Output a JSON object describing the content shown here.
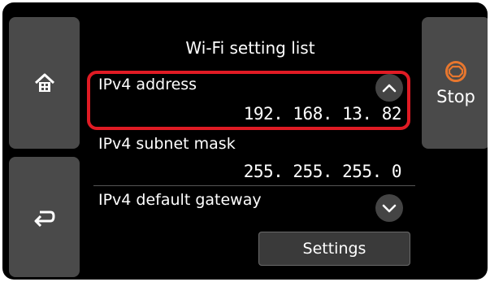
{
  "header": {
    "title": "Wi-Fi setting list"
  },
  "nav": {
    "home_icon": "home-icon",
    "back_icon": "back-arrow-icon",
    "stop_label": "Stop",
    "stop_icon": "stop-icon",
    "stop_color": "#e8772e"
  },
  "settings_list": {
    "items": [
      {
        "label": "IPv4 address",
        "value": "192. 168. 13. 82"
      },
      {
        "label": "IPv4 subnet mask",
        "value": "255. 255. 255. 0"
      },
      {
        "label": "IPv4 default gateway",
        "value": ""
      }
    ],
    "highlight_color": "#e01b24",
    "scroll_up_icon": "chevron-up-icon",
    "scroll_down_icon": "chevron-down-icon"
  },
  "footer": {
    "settings_label": "Settings"
  }
}
